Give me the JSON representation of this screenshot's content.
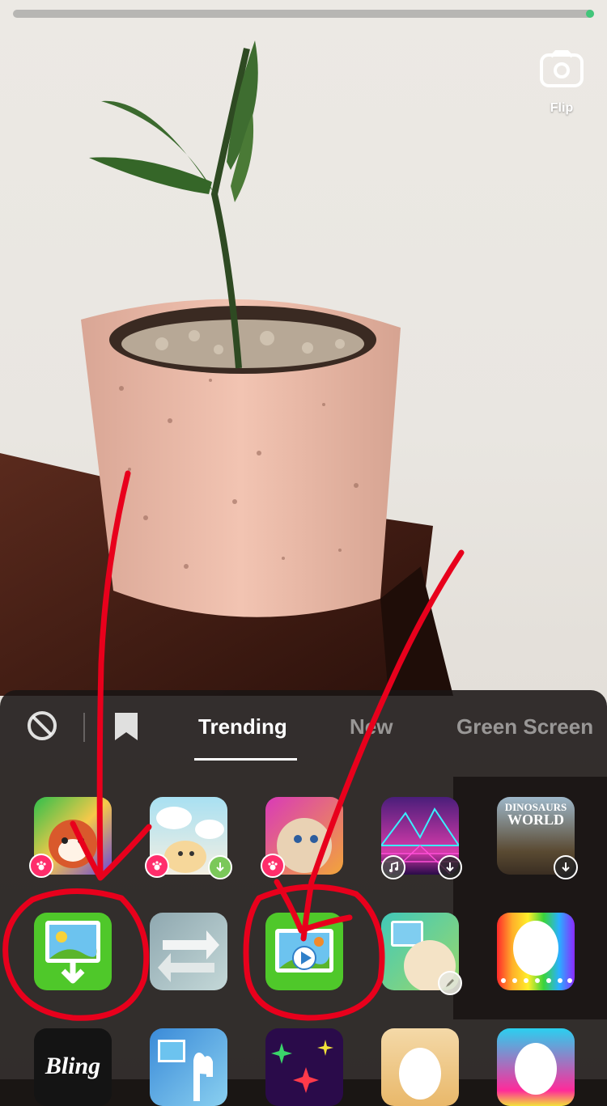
{
  "flip": {
    "label": "Flip"
  },
  "tabs": [
    {
      "label": "Trending",
      "active": true
    },
    {
      "label": "New",
      "active": false
    },
    {
      "label": "Green Screen",
      "active": false
    }
  ],
  "effects": {
    "dinosaurs_world": {
      "line1": "DINOSAURS",
      "line2": "WORLD"
    },
    "bling": {
      "text": "Bling"
    }
  },
  "colors": {
    "annotation": "#e8001c",
    "progress": "#42c67a",
    "underline": "#ffffff"
  }
}
